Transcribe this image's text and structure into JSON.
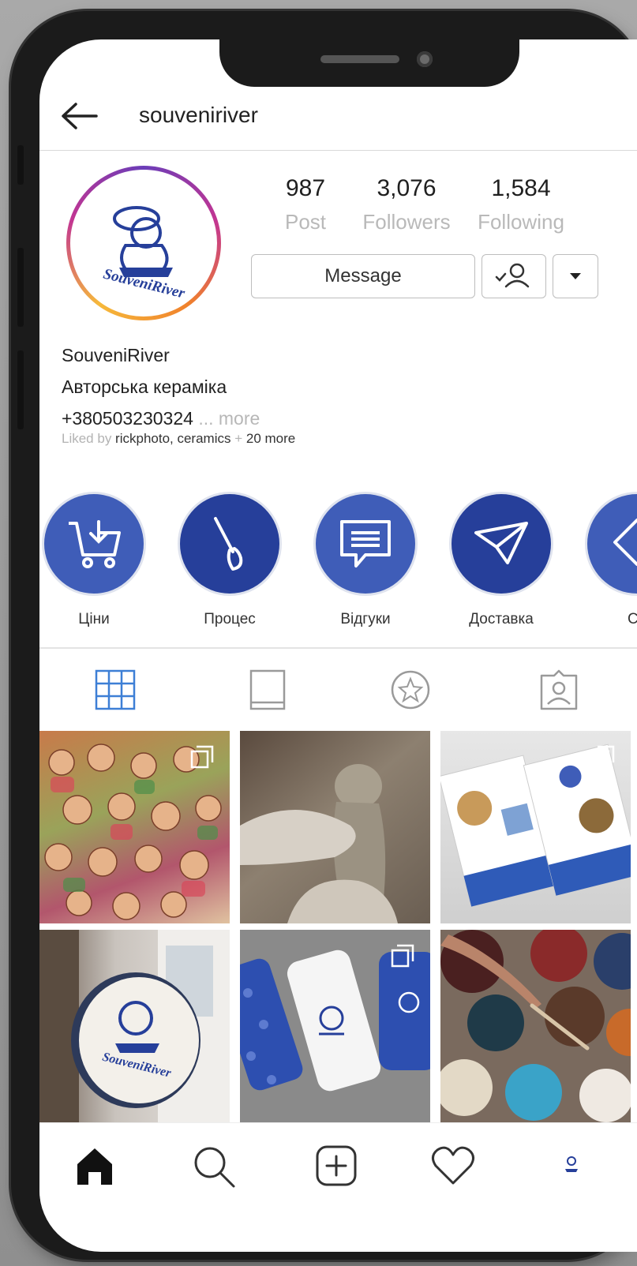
{
  "header": {
    "username": "souveniriver"
  },
  "profile": {
    "avatar_logo_text": "SouveniRiver",
    "stats": [
      {
        "value": "987",
        "label": "Post"
      },
      {
        "value": "3,076",
        "label": "Followers"
      },
      {
        "value": "1,584",
        "label": "Following"
      }
    ],
    "message_label": "Message",
    "bio": {
      "name": "SouveniRiver",
      "description": "Авторська кераміка",
      "phone": "+380503230324",
      "more": "... more"
    },
    "liked_by": {
      "prefix": "Liked by ",
      "users": "rickphoto, ceramics",
      "separator": " + ",
      "others": "20 more"
    }
  },
  "highlights": [
    {
      "label": "Ціни",
      "icon": "cart-icon",
      "color": "#3f5db8"
    },
    {
      "label": "Процес",
      "icon": "brush-icon",
      "color": "#263f9a"
    },
    {
      "label": "Відгуки",
      "icon": "message-icon",
      "color": "#3f5db8"
    },
    {
      "label": "Доставка",
      "icon": "paper-plane-icon",
      "color": "#263f9a"
    },
    {
      "label": "Сп",
      "icon": "tag-icon",
      "color": "#3f5db8"
    }
  ],
  "tabs": [
    {
      "icon": "grid-icon",
      "active": true
    },
    {
      "icon": "feed-icon",
      "active": false
    },
    {
      "icon": "star-icon",
      "active": false
    },
    {
      "icon": "tagged-icon",
      "active": false
    }
  ],
  "posts": [
    {
      "subject": "ceramic figurines",
      "multi": true
    },
    {
      "subject": "clay sculpting",
      "multi": false
    },
    {
      "subject": "brochures",
      "multi": true
    },
    {
      "subject": "shop sign",
      "multi": false
    },
    {
      "subject": "phone cases",
      "multi": true
    },
    {
      "subject": "paint jars",
      "multi": false
    }
  ],
  "bottom_nav": [
    "home-icon",
    "search-icon",
    "add-post-icon",
    "heart-icon",
    "profile-avatar"
  ],
  "colors": {
    "brand_blue": "#263f9a",
    "highlight_blue": "#3f5db8",
    "active_tab": "#3d7fd6",
    "muted_text": "#b9b9b9"
  }
}
